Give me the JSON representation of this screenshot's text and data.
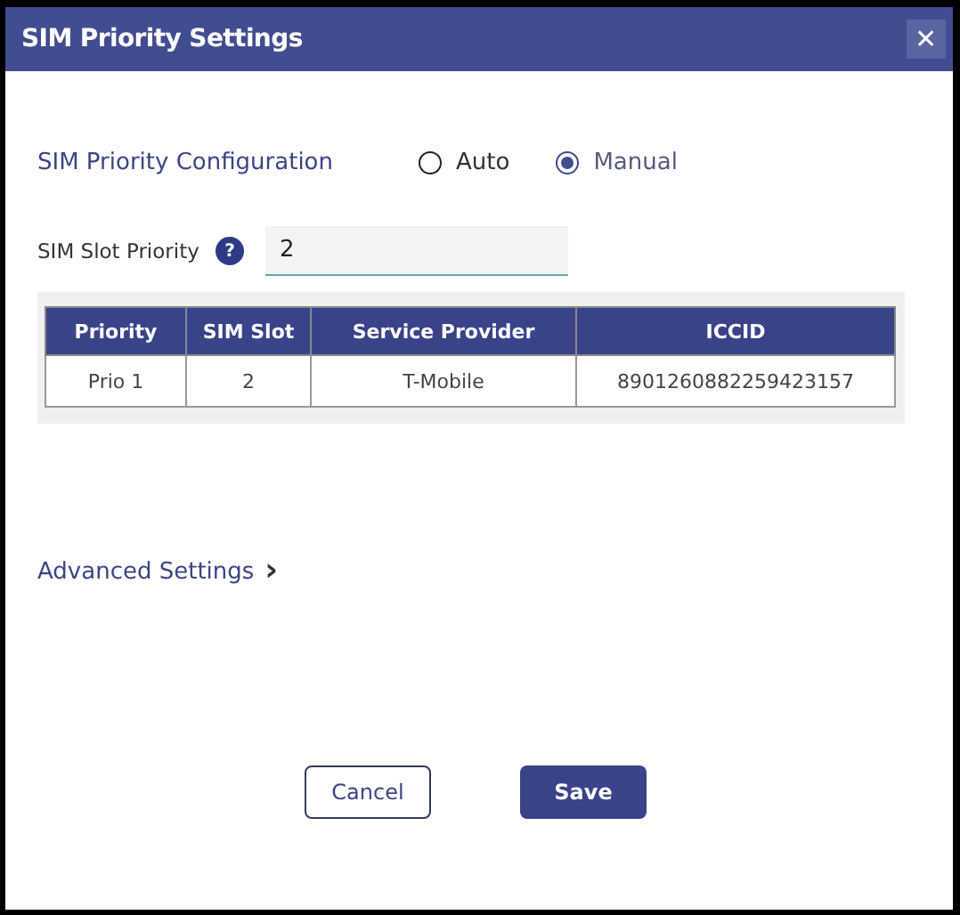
{
  "window": {
    "title": "SIM Priority Settings",
    "close": "✕"
  },
  "configuration": {
    "label": "SIM Priority Configuration",
    "options": [
      {
        "label": "Auto",
        "selected": false
      },
      {
        "label": "Manual",
        "selected": true
      }
    ]
  },
  "slot_priority": {
    "label": "SIM Slot Priority",
    "help": "?",
    "value": "2"
  },
  "table": {
    "columns": [
      "Priority",
      "SIM Slot",
      "Service Provider",
      "ICCID"
    ],
    "rows": [
      [
        "Prio 1",
        "2",
        "T-Mobile",
        "8901260882259423157"
      ]
    ]
  },
  "advanced": {
    "label": "Advanced Settings",
    "arrow": "›"
  },
  "buttons": [
    {
      "label": "Cancel",
      "kind": "secondary"
    },
    {
      "label": "Save",
      "kind": "primary"
    }
  ]
}
